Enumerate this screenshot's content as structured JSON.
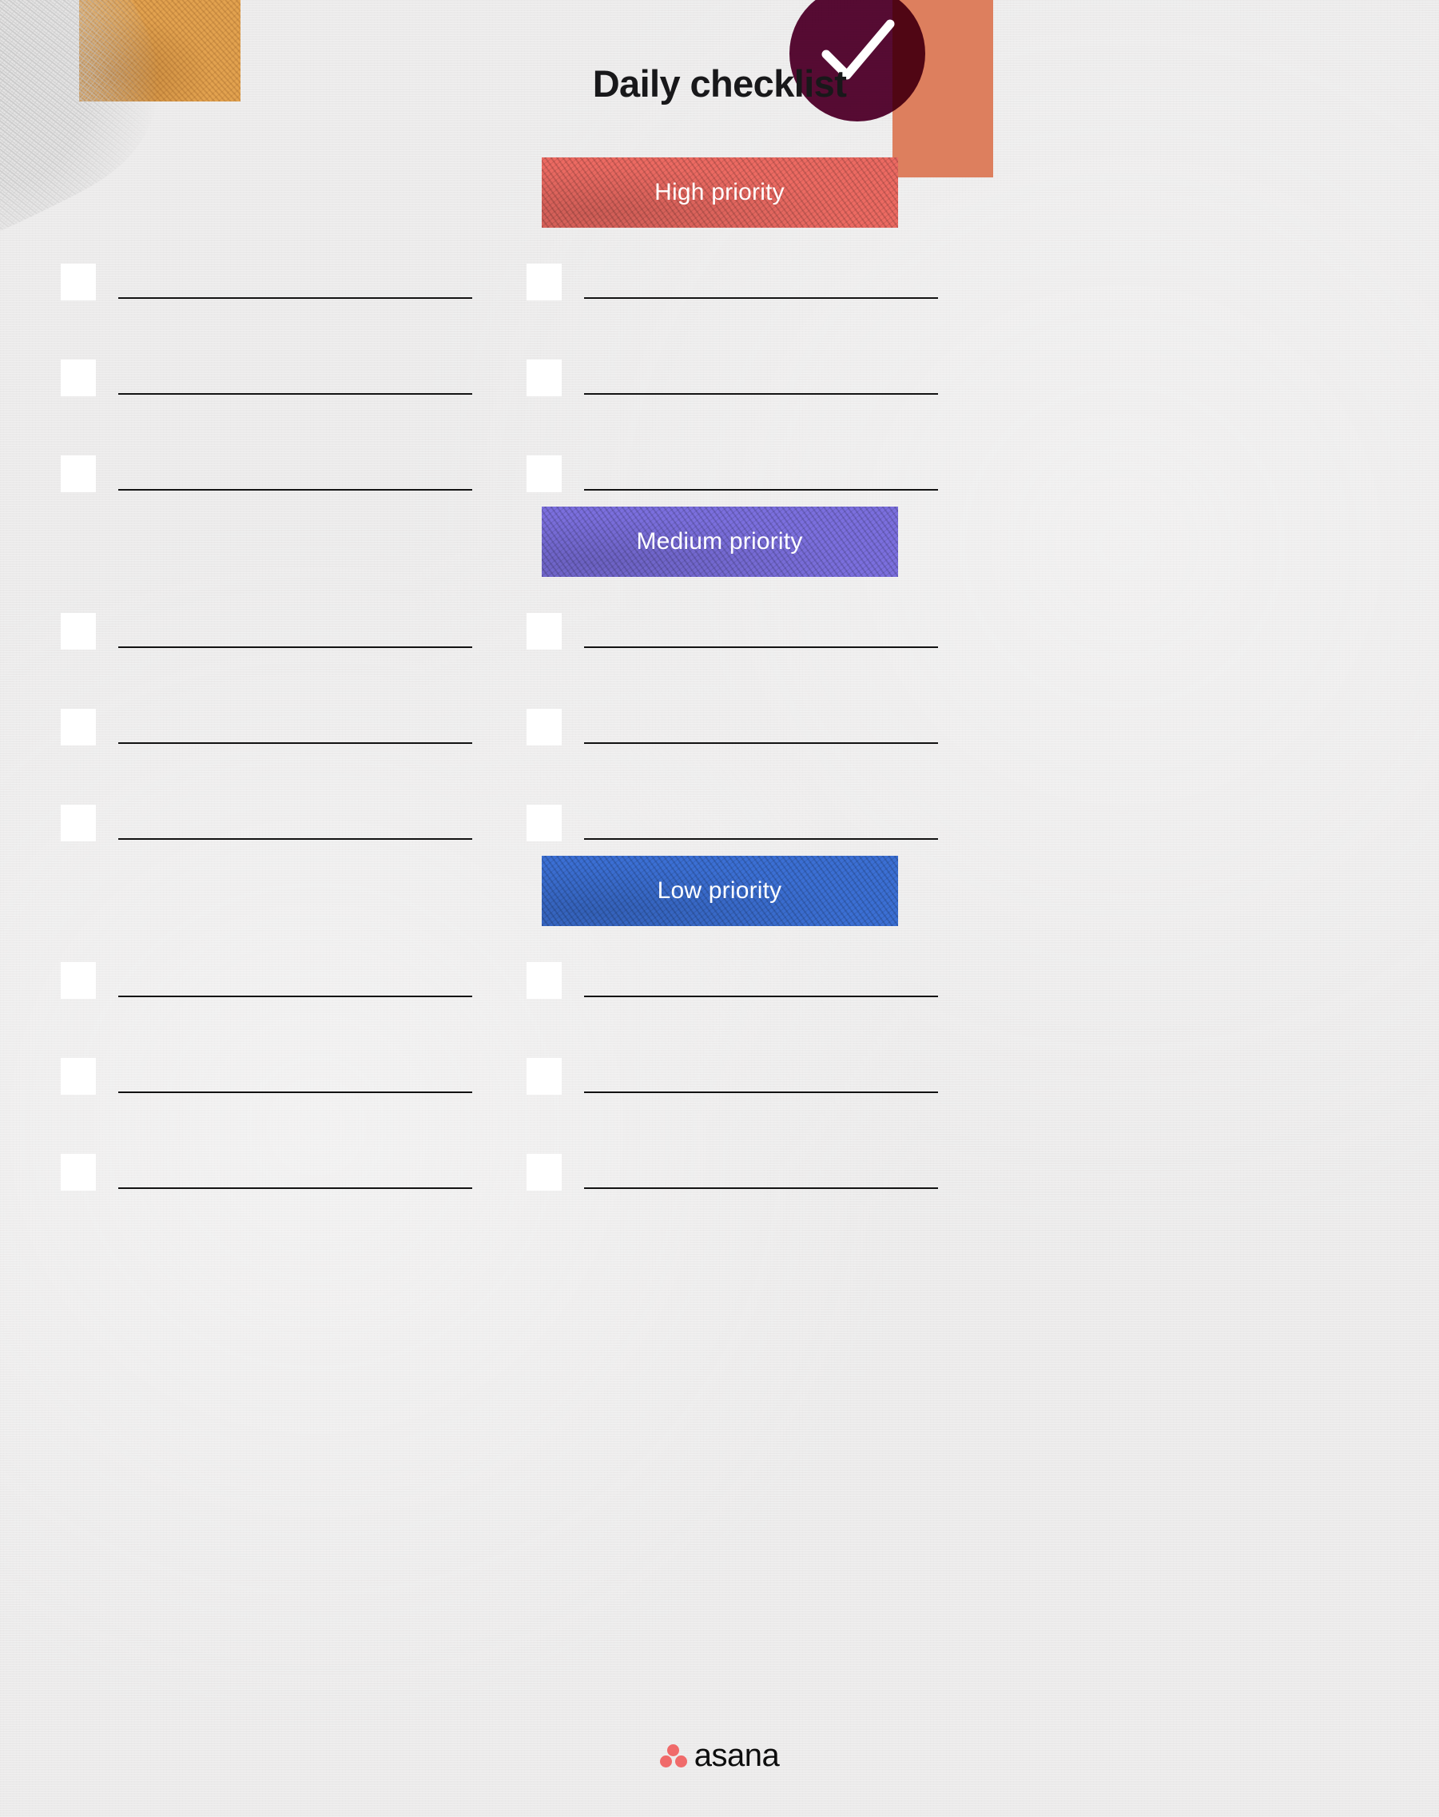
{
  "page": {
    "title": "Daily checklist",
    "background_color": "#EBEAEA"
  },
  "decorations": {
    "amber_block": {
      "name": "amber-square",
      "color": "#E2A24F"
    },
    "brush_stroke": {
      "name": "gray-brush-texture",
      "color": "#C9C9C9"
    },
    "salmon_block": {
      "name": "salmon-rectangle",
      "color": "#DD7F5E"
    },
    "check_badge": {
      "name": "check-circle",
      "color": "#5C0B36",
      "glyph": "check-icon",
      "glyph_color": "#FFFFFF"
    }
  },
  "sections": [
    {
      "id": "high",
      "banner_label": "High priority",
      "banner_color": "#EC6A62",
      "rows": 3,
      "columns": 2
    },
    {
      "id": "medium",
      "banner_label": "Medium priority",
      "banner_color": "#7B6FDE",
      "rows": 3,
      "columns": 2
    },
    {
      "id": "low",
      "banner_label": "Low priority",
      "banner_color": "#3B6FD4",
      "rows": 3,
      "columns": 2
    }
  ],
  "checkbox": {
    "state": "unchecked",
    "fill_color": "#FFFFFF"
  },
  "write_line": {
    "color": "#121212",
    "placeholder": ""
  },
  "brand": {
    "name": "asana",
    "wordmark": "asana",
    "dot_color": "#F06A6A",
    "wordmark_color": "#0D0D0D"
  }
}
